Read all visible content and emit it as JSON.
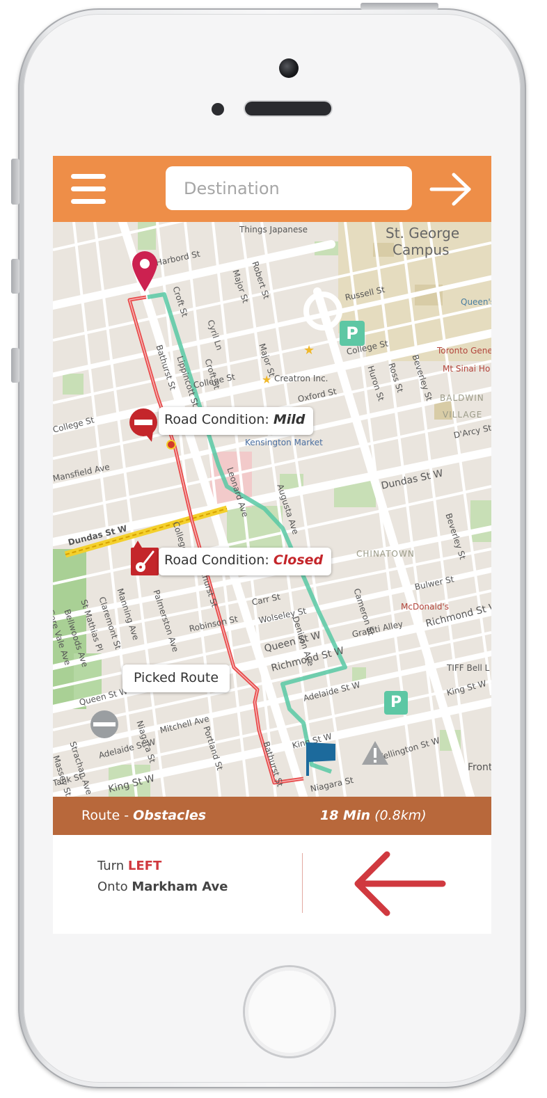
{
  "topbar": {
    "menu_icon": "hamburger-menu-icon",
    "destination_placeholder": "Destination",
    "go_icon": "arrow-right-icon",
    "background_color": "#ee8e48"
  },
  "map": {
    "labels": [
      {
        "text": "Things Japanese"
      },
      {
        "text": "St. George"
      },
      {
        "text": "Campus"
      },
      {
        "text": "Harbord St"
      },
      {
        "text": "Croft St"
      },
      {
        "text": "Major St"
      },
      {
        "text": "Robert St"
      },
      {
        "text": "Russell St"
      },
      {
        "text": "Queen's"
      },
      {
        "text": "Cyril Ln"
      },
      {
        "text": "Bathurst St"
      },
      {
        "text": "Lippincott St"
      },
      {
        "text": "Croft St"
      },
      {
        "text": "Major St"
      },
      {
        "text": "College St"
      },
      {
        "text": "Huron St"
      },
      {
        "text": "Ross St"
      },
      {
        "text": "Beverley St"
      },
      {
        "text": "Toronto Gene"
      },
      {
        "text": "Mt Sinai Ho"
      },
      {
        "text": "College St"
      },
      {
        "text": "Creatron Inc."
      },
      {
        "text": "Oxford St"
      },
      {
        "text": "BALDWIN"
      },
      {
        "text": "VILLAGE"
      },
      {
        "text": "College St"
      },
      {
        "text": "Kensington Market"
      },
      {
        "text": "D'Arcy St"
      },
      {
        "text": "Leonard Ave"
      },
      {
        "text": "Augusta Ave"
      },
      {
        "text": "Dundas St W"
      },
      {
        "text": "Beverley St"
      },
      {
        "text": "Mansfield Ave"
      },
      {
        "text": "College Pl"
      },
      {
        "text": "Bathurst St"
      },
      {
        "text": "CHINATOWN"
      },
      {
        "text": "Dundas St W"
      },
      {
        "text": "Gore Vale Ave"
      },
      {
        "text": "Bellwoods Ave"
      },
      {
        "text": "St Mathias Pl"
      },
      {
        "text": "Claremont St"
      },
      {
        "text": "Manning Ave"
      },
      {
        "text": "Palmerston Ave"
      },
      {
        "text": "Carr St"
      },
      {
        "text": "Cameron St"
      },
      {
        "text": "Bulwer St"
      },
      {
        "text": "McDonald's"
      },
      {
        "text": "Wolseley St"
      },
      {
        "text": "Denison Ave"
      },
      {
        "text": "Robinson St"
      },
      {
        "text": "Graffiti Alley"
      },
      {
        "text": "Richmond St W"
      },
      {
        "text": "Queen St W"
      },
      {
        "text": "Richmond St W"
      },
      {
        "text": "TIFF Bell L"
      },
      {
        "text": "Queen St W"
      },
      {
        "text": "Adelaide St W"
      },
      {
        "text": "King St W"
      },
      {
        "text": "Strachan Ave"
      },
      {
        "text": "Niagara St"
      },
      {
        "text": "Mitchell Ave"
      },
      {
        "text": "Portland St"
      },
      {
        "text": "Massey St"
      },
      {
        "text": "Adelaide St W"
      },
      {
        "text": "Bathurst St"
      },
      {
        "text": "King St W"
      },
      {
        "text": "Wellington St W"
      },
      {
        "text": "Front"
      },
      {
        "text": "King St W"
      },
      {
        "text": "Niagara St"
      },
      {
        "text": "Tank St"
      }
    ],
    "callouts": {
      "mild": {
        "prefix": "Road Condition: ",
        "value": "Mild"
      },
      "closed": {
        "prefix": "Road Condition: ",
        "value": "Closed"
      },
      "picked": {
        "text": "Picked Route"
      }
    },
    "icons": {
      "start_pin": "location-pin-icon",
      "destination_flag": "flag-icon",
      "mild_marker": "no-entry-icon",
      "closed_marker": "guitar-icon",
      "parking_1": "parking-icon",
      "parking_2": "parking-icon",
      "blocked": "blocked-road-icon",
      "warning": "warning-icon"
    },
    "route_colors": {
      "obstacle_route": "#e84b4b",
      "picked_route": "#58c9a5"
    }
  },
  "route_bar": {
    "label_prefix": "Route - ",
    "label_value": "Obstacles",
    "duration": "18 Min",
    "distance": "(0.8km)",
    "background_color": "#b8683b"
  },
  "directions": {
    "turn_prefix": "Turn ",
    "turn_direction": "LEFT",
    "onto_prefix": "Onto ",
    "street": "Markham Ave",
    "arrow_icon": "arrow-left-icon",
    "accent_color": "#d0393f"
  }
}
